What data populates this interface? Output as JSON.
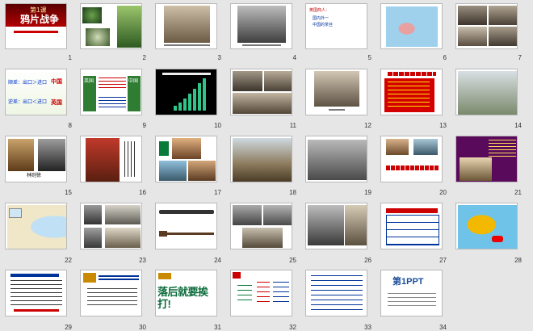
{
  "slides": [
    {
      "num": "1",
      "title": "鸦片战争",
      "subtitle": "第1课"
    },
    {
      "num": "2"
    },
    {
      "num": "3"
    },
    {
      "num": "4"
    },
    {
      "num": "5",
      "lines": [
        "英国商人：",
        "国内外一",
        "中国的茶丝"
      ]
    },
    {
      "num": "6"
    },
    {
      "num": "7"
    },
    {
      "num": "8",
      "lines": [
        "顺差：出口＞进口",
        "逆差：出口＜进口"
      ],
      "labels": [
        "中国",
        "英国"
      ]
    },
    {
      "num": "9",
      "labels": [
        "英国",
        "中国"
      ]
    },
    {
      "num": "10"
    },
    {
      "num": "11"
    },
    {
      "num": "12"
    },
    {
      "num": "13"
    },
    {
      "num": "14"
    },
    {
      "num": "15",
      "caption": "林则徐"
    },
    {
      "num": "16"
    },
    {
      "num": "17"
    },
    {
      "num": "18"
    },
    {
      "num": "19"
    },
    {
      "num": "20"
    },
    {
      "num": "21"
    },
    {
      "num": "22"
    },
    {
      "num": "23"
    },
    {
      "num": "24"
    },
    {
      "num": "25"
    },
    {
      "num": "26"
    },
    {
      "num": "27"
    },
    {
      "num": "28"
    },
    {
      "num": "29"
    },
    {
      "num": "30"
    },
    {
      "num": "31",
      "big": "落后就要挨打!"
    },
    {
      "num": "32"
    },
    {
      "num": "33"
    },
    {
      "num": "34",
      "brand": "第1PPT"
    }
  ]
}
